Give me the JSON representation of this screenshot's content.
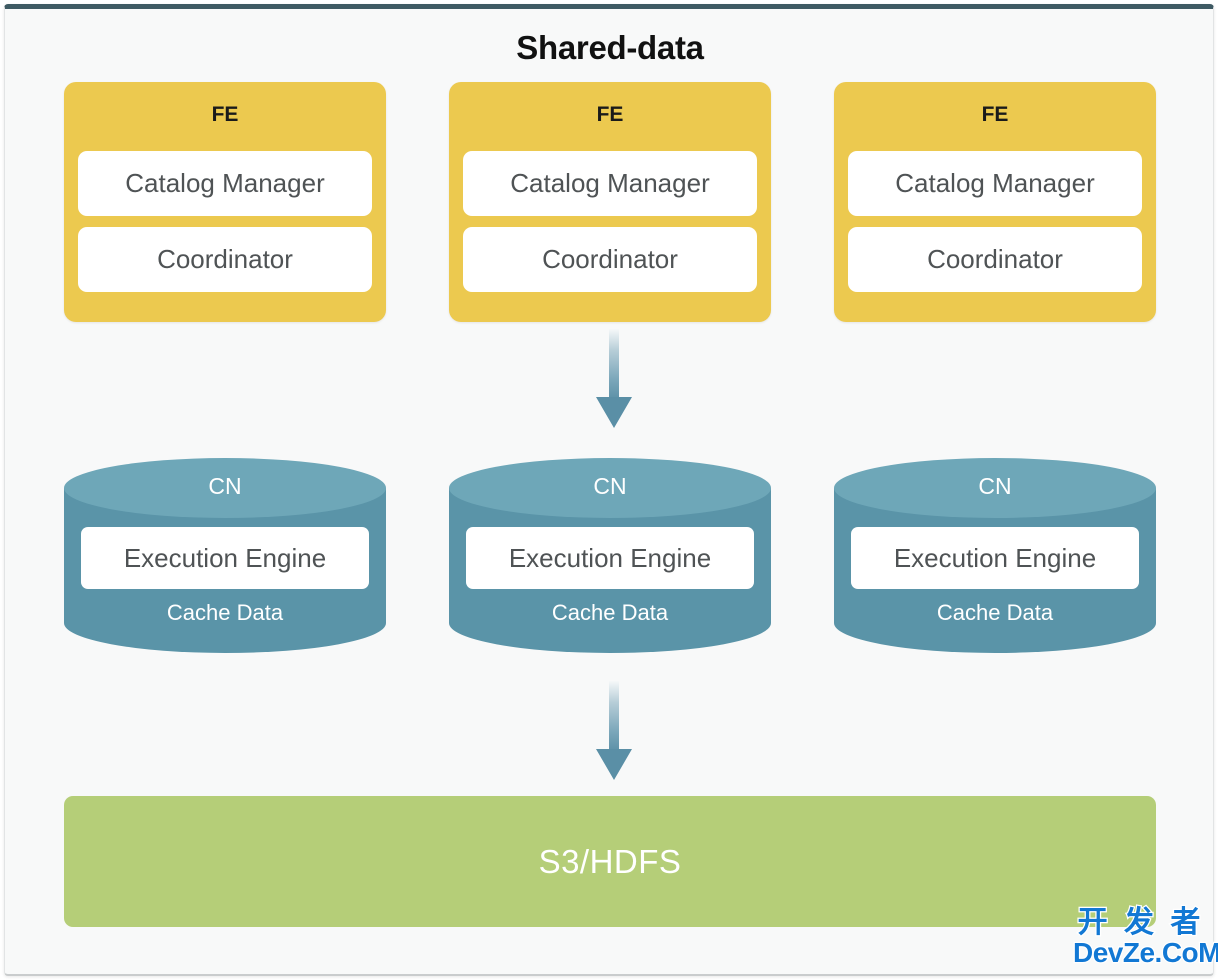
{
  "diagram": {
    "title": "Shared-data",
    "type": "architecture-diagram",
    "frame": {
      "background_color": "#f8f9f9",
      "top_border_color": "#3e5a63"
    },
    "colors": {
      "fe_fill": "#ecc94f",
      "fe_text": "#1a1a1a",
      "cn_body_fill": "#5a94a8",
      "cn_top_fill": "#6ea7b8",
      "cn_text": "#ffffff",
      "subbox_fill": "#ffffff",
      "subbox_text": "#4f5355",
      "storage_fill": "#b5ce78",
      "storage_text": "#ffffff",
      "arrow_color": "#5a8fa6",
      "title_text": "#111111"
    }
  },
  "tiers": {
    "frontend": {
      "tier_name": "FE",
      "count": 3,
      "nodes": [
        {
          "label": "FE",
          "components": [
            "Catalog Manager",
            "Coordinator"
          ]
        },
        {
          "label": "FE",
          "components": [
            "Catalog Manager",
            "Coordinator"
          ]
        },
        {
          "label": "FE",
          "components": [
            "Catalog Manager",
            "Coordinator"
          ]
        }
      ]
    },
    "compute": {
      "tier_name": "CN",
      "count": 3,
      "shape": "cylinder",
      "nodes": [
        {
          "label": "CN",
          "engine": "Execution Engine",
          "cache": "Cache Data"
        },
        {
          "label": "CN",
          "engine": "Execution Engine",
          "cache": "Cache Data"
        },
        {
          "label": "CN",
          "engine": "Execution Engine",
          "cache": "Cache Data"
        }
      ]
    },
    "storage": {
      "label": "S3/HDFS"
    }
  },
  "connectors": [
    {
      "name": "fe-to-cn",
      "direction": "down",
      "from": "FE",
      "to": "CN"
    },
    {
      "name": "cn-to-storage",
      "direction": "down",
      "from": "CN",
      "to": "S3/HDFS"
    }
  ],
  "watermark": {
    "chinese": "开 发 者",
    "latin": "DevZe.CoM",
    "color": "#1278d4"
  }
}
